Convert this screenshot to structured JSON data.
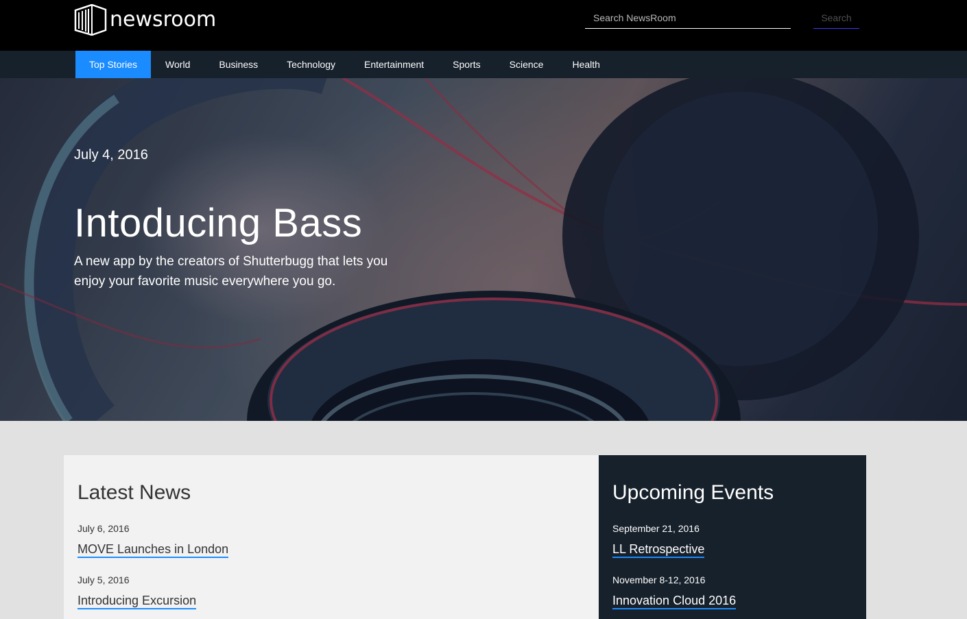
{
  "header": {
    "logo_text": "newsroom",
    "search_placeholder": "Search NewsRoom",
    "search_button": "Search"
  },
  "nav": {
    "items": [
      {
        "label": "Top Stories",
        "active": true
      },
      {
        "label": "World"
      },
      {
        "label": "Business"
      },
      {
        "label": "Technology"
      },
      {
        "label": "Entertainment"
      },
      {
        "label": "Sports"
      },
      {
        "label": "Science"
      },
      {
        "label": "Health"
      }
    ]
  },
  "hero": {
    "date": "July 4, 2016",
    "title": "Intoducing Bass",
    "subtitle": "A new app by the creators of Shutterbugg that lets you enjoy your favorite music everywhere you go."
  },
  "latest": {
    "title": "Latest News",
    "items": [
      {
        "date": "July 6, 2016",
        "title": "MOVE Launches in London"
      },
      {
        "date": "July 5, 2016",
        "title": "Introducing Excursion"
      }
    ]
  },
  "events": {
    "title": "Upcoming Events",
    "items": [
      {
        "date": "September 21, 2016",
        "title": "LL Retrospective"
      },
      {
        "date": "November 8-12, 2016",
        "title": "Innovation Cloud 2016"
      }
    ]
  },
  "colors": {
    "accent": "#1a8cff",
    "nav_bg": "#17212b",
    "header_bg": "#000000"
  }
}
